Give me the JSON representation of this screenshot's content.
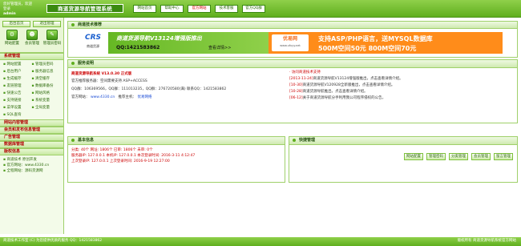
{
  "header": {
    "welcome": "您好管理员，欢迎登录",
    "username": "admin",
    "brand": "商道货源导航管理系统",
    "tabs": [
      {
        "label": "网站首页",
        "active": false
      },
      {
        "label": "帮助中心",
        "active": false
      },
      {
        "label": "官方网站",
        "active": true
      },
      {
        "label": "技术客服",
        "active": false
      },
      {
        "label": "官方QQ群",
        "active": false
      }
    ]
  },
  "sidebar": {
    "top_buttons": [
      "后台首页",
      "退出管理"
    ],
    "icons": [
      {
        "label": "网站配置",
        "icon": "gear-icon",
        "glyph": "⚙"
      },
      {
        "label": "会员管理",
        "icon": "users-icon",
        "glyph": "☻"
      },
      {
        "label": "管理员密码",
        "icon": "lock-icon",
        "glyph": "✎"
      }
    ],
    "sections": [
      {
        "title": "系统管理",
        "links": [
          "网站配置",
          "管理员密码",
          "后台用户",
          "服务器信息",
          "生成缓存",
          "清空缓存",
          "友链管理",
          "数据库备份",
          "快速公告",
          "网站风格",
          "支持链接",
          "系统变量",
          "菜单设置",
          "全局变量",
          "SQL查询",
          ""
        ]
      },
      {
        "title": "网站内容管理",
        "links": []
      },
      {
        "title": "会员和发布信息管理",
        "links": []
      },
      {
        "title": "广告管理",
        "links": []
      },
      {
        "title": "数据库管理",
        "links": []
      },
      {
        "title": "版权信息",
        "links": [
          "商道技术 原创开发",
          "官方网站：www.4330.cn",
          "全程网站：源码货源网"
        ]
      }
    ]
  },
  "ad": {
    "header": "商道技术推荐",
    "logo": "CRS",
    "logo_sub": "商道货源",
    "promo_line1": "商道货源导航V13124增强版推出",
    "promo_line2": "QQ:1421583862",
    "promo_btn": "查看详情>>",
    "host_name": "优易网",
    "host_url": "www.ufuyy.net",
    "right_line1": "支持ASP/PHP语言，送MYSQL数据库",
    "right_line2": "500M空间50元 800M空间70元"
  },
  "service": {
    "header": "服务说明",
    "title": "商道货源导航系统 V13.0.30 正式版",
    "lines": [
      {
        "k": "官方推荐服务器：",
        "v": "空间需要支持 ASP+ACCESS"
      },
      {
        "k": "QQ群：",
        "v": "106369566，QQ群：111013235，QQ群：276720580(满)  联系QQ：1421583862"
      },
      {
        "k": "官方网站：",
        "v": "www.4330.cn",
        "k2": "推荐主机：",
        "v2": "优易网络"
      }
    ],
    "news": [
      {
        "date": "",
        "text": "· 访问商道技术支持"
      },
      {
        "date": "[2013-11-24]",
        "text": "商道货源导航V13124增强版推出，点击查看详情介绍。"
      },
      {
        "date": "[10-30]",
        "text": "商道货源导航V120928全新版推出，点击查看详情介绍。"
      },
      {
        "date": "[10-28]",
        "text": "商道货源导航推出，点击查看详情介绍。"
      },
      {
        "date": "[06-12]",
        "text": "关于商道货源导航分手利用我公司程序侵权的公告。"
      }
    ]
  },
  "basic_info": {
    "header": "基本信息",
    "line1": "分类: 40个  网址: 1806个  已审: 1806个  未审: 0个",
    "line2": "服务器IP: 127.0.0.1  本机IP: 127.0.0.1  本次登录时间: 2016-3-11 4:12:47",
    "line3": "上次登录IP: 127.0.0.1  上次登录时间: 2016-9-19 12:27:00"
  },
  "quick": {
    "header": "快捷管理",
    "buttons": [
      "网站配置",
      "管理密码",
      "分类管理",
      "会员管理",
      "留言管理"
    ]
  },
  "footer": {
    "left": "商道技术工作室  (C) 为您提供优质的服务  QQ：1421583862",
    "right": "版权所有 商道货源导航系统官方网站"
  }
}
